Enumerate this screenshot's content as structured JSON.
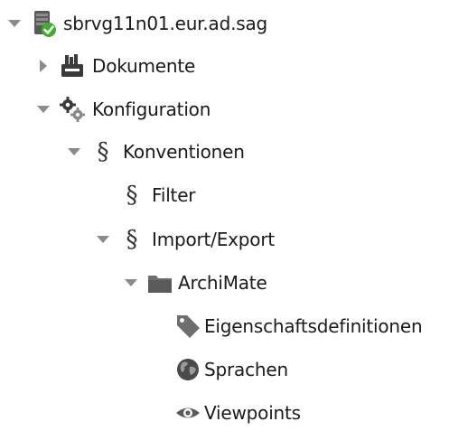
{
  "tree": {
    "root": {
      "label": "sbrvg11n01.eur.ad.sag",
      "icon": "server-online-icon",
      "expanded": true
    },
    "dokumente": {
      "label": "Dokumente",
      "icon": "documents-icon",
      "expanded": false
    },
    "konfiguration": {
      "label": "Konfiguration",
      "icon": "gears-icon",
      "expanded": true
    },
    "konventionen": {
      "label": "Konventionen",
      "icon": "section-sign-icon",
      "expanded": true
    },
    "filter": {
      "label": "Filter",
      "icon": "section-sign-icon"
    },
    "import_export": {
      "label": "Import/Export",
      "icon": "section-sign-icon",
      "expanded": true
    },
    "archimate": {
      "label": "ArchiMate",
      "icon": "folder-icon",
      "expanded": true
    },
    "eigenschaften": {
      "label": "Eigenschaftsdefinitionen",
      "icon": "tag-icon"
    },
    "sprachen": {
      "label": "Sprachen",
      "icon": "globe-icon"
    },
    "viewpoints": {
      "label": "Viewpoints",
      "icon": "eye-icon"
    }
  },
  "colors": {
    "text": "#1a1a1a",
    "toggle": "#8a8a8a",
    "icon_dark": "#3a3a3a",
    "icon_gray": "#6e6e6e",
    "check_green": "#3fae2a"
  }
}
